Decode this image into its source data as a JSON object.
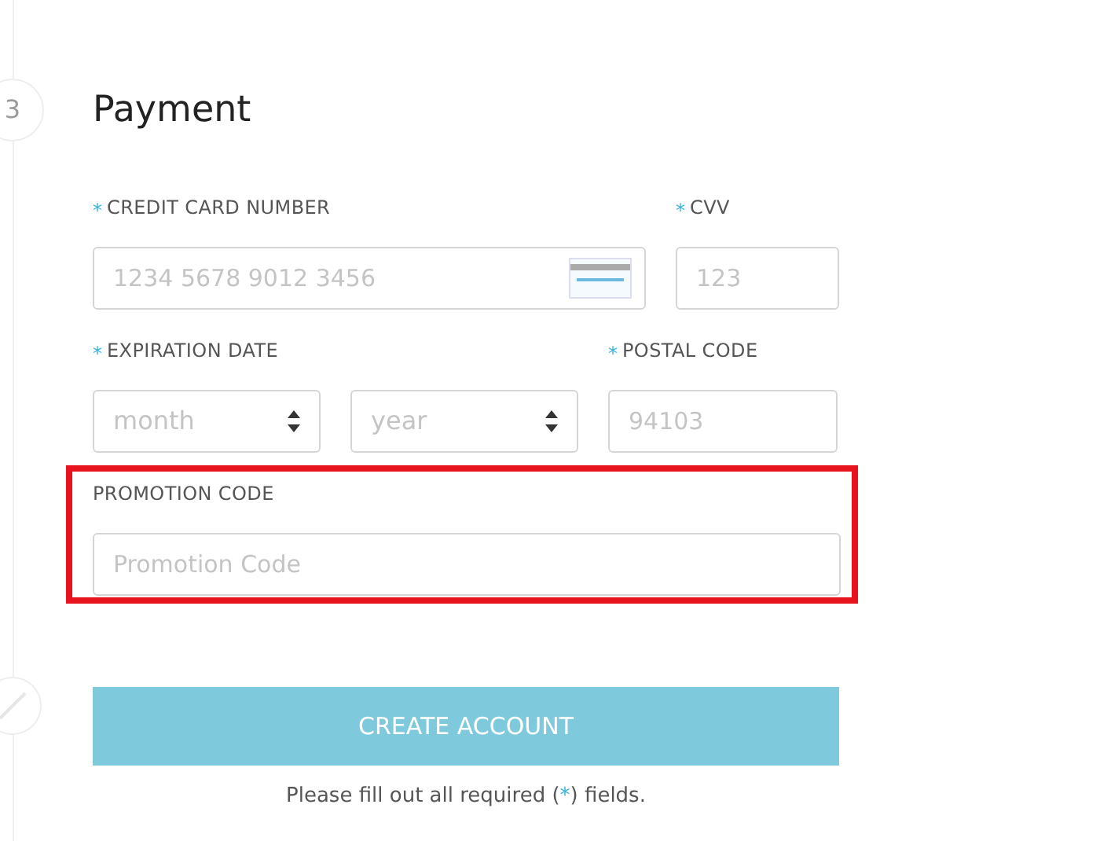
{
  "step": {
    "number": "3"
  },
  "title": "Payment",
  "rows": [
    [
      {
        "kind": "input",
        "label": "CREDIT CARD NUMBER",
        "required": true,
        "placeholder": "1234 5678 9012 3456",
        "card_icon": true
      },
      {
        "kind": "input",
        "label": "CVV",
        "required": true,
        "placeholder": "123"
      }
    ],
    [
      {
        "kind": "selects",
        "label": "EXPIRATION DATE",
        "required": true,
        "options": [
          "month",
          "year"
        ]
      },
      {
        "kind": "input",
        "label": "POSTAL CODE",
        "required": true,
        "placeholder": "94103"
      }
    ],
    [
      {
        "kind": "input",
        "label": "PROMOTION CODE",
        "required": false,
        "placeholder": "Promotion Code",
        "highlighted": true
      }
    ]
  ],
  "submit": {
    "label": "CREATE ACCOUNT",
    "disabled": true
  },
  "note": {
    "before": "Please fill out all required (",
    "mark": "*",
    "after": ") fields."
  }
}
